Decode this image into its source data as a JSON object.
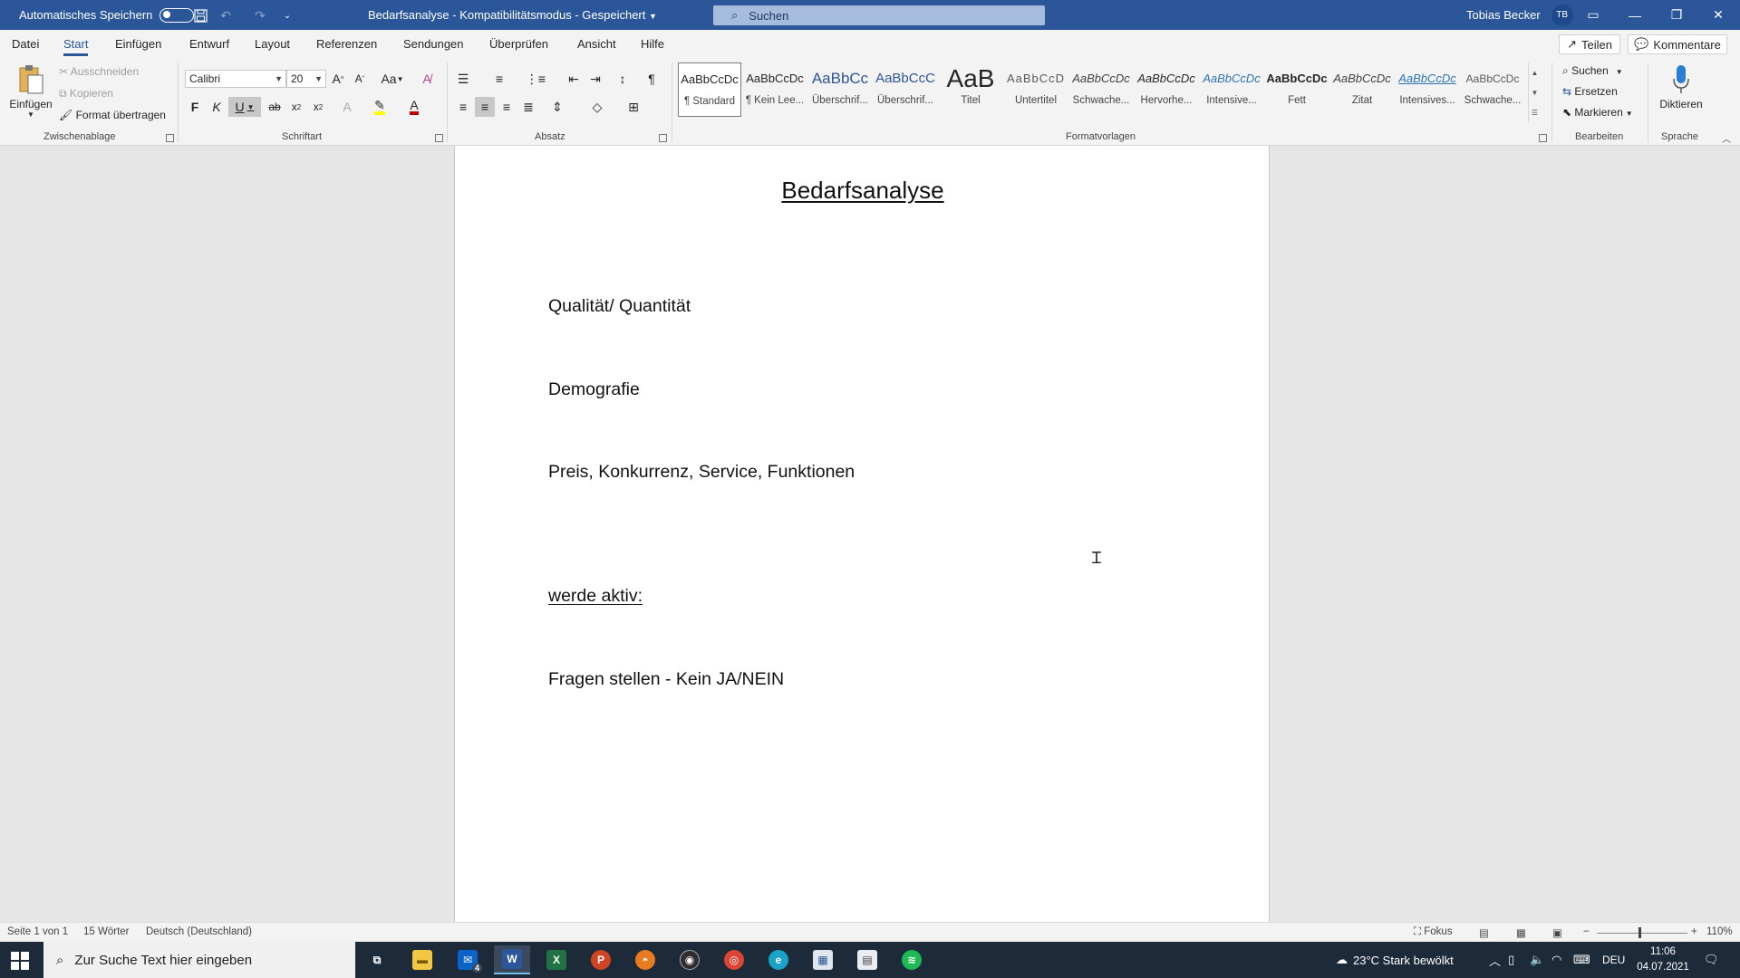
{
  "titlebar": {
    "autosave_label": "Automatisches Speichern",
    "document_title": "Bedarfsanalyse  -  Kompatibilitätsmodus  -  Gespeichert",
    "search_placeholder": "Suchen",
    "user_name": "Tobias Becker",
    "user_initials": "TB"
  },
  "tabs": [
    "Datei",
    "Start",
    "Einfügen",
    "Entwurf",
    "Layout",
    "Referenzen",
    "Sendungen",
    "Überprüfen",
    "Ansicht",
    "Hilfe"
  ],
  "active_tab": "Start",
  "share_label": "Teilen",
  "comments_label": "Kommentare",
  "ribbon": {
    "clipboard": {
      "paste": "Einfügen",
      "cut": "Ausschneiden",
      "copy": "Kopieren",
      "format_painter": "Format übertragen",
      "group": "Zwischenablage"
    },
    "font": {
      "name": "Calibri",
      "size": "20",
      "case": "Aa",
      "bold": "F",
      "italic": "K",
      "underline": "U",
      "group": "Schriftart"
    },
    "paragraph": {
      "group": "Absatz"
    },
    "styles": {
      "group": "Formatvorlagen",
      "items": [
        {
          "preview": "AaBbCcDc",
          "name": "¶ Standard"
        },
        {
          "preview": "AaBbCcDc",
          "name": "¶ Kein Lee..."
        },
        {
          "preview": "AaBbCc",
          "name": "Überschrif..."
        },
        {
          "preview": "AaBbCcC",
          "name": "Überschrif..."
        },
        {
          "preview": "AaB",
          "name": "Titel"
        },
        {
          "preview": "AaBbCcD",
          "name": "Untertitel"
        },
        {
          "preview": "AaBbCcDc",
          "name": "Schwache..."
        },
        {
          "preview": "AaBbCcDc",
          "name": "Hervorhe..."
        },
        {
          "preview": "AaBbCcDc",
          "name": "Intensive..."
        },
        {
          "preview": "AaBbCcDc",
          "name": "Fett"
        },
        {
          "preview": "AaBbCcDc",
          "name": "Zitat"
        },
        {
          "preview": "AaBbCcDc",
          "name": "Intensives..."
        },
        {
          "preview": "AaBbCcDc",
          "name": "Schwache..."
        }
      ]
    },
    "editing": {
      "find": "Suchen",
      "replace": "Ersetzen",
      "select": "Markieren",
      "group": "Bearbeiten"
    },
    "voice": {
      "dictate": "Diktieren",
      "group": "Sprache"
    }
  },
  "document": {
    "heading": "Bedarfsanalyse",
    "lines": [
      "Qualität/ Quantität",
      "Demografie",
      "Preis, Konkurrenz, Service, Funktionen",
      "werde aktiv:",
      "Fragen stellen - Kein JA/NEIN"
    ]
  },
  "statusbar": {
    "page": "Seite 1 von 1",
    "words": "15 Wörter",
    "language": "Deutsch (Deutschland)",
    "focus": "Fokus",
    "zoom": "110%",
    "zoom_minus": "−",
    "zoom_plus": "+"
  },
  "taskbar": {
    "search_placeholder": "Zur Suche Text hier eingeben",
    "mail_badge": "4",
    "weather": "23°C  Stark bewölkt",
    "language": "DEU",
    "time": "11:06",
    "date": "04.07.2021"
  },
  "colors": {
    "word_blue": "#2b579a",
    "ribbon_bg": "#f3f3f3",
    "canvas_bg": "#e6e6e6",
    "taskbar_bg": "#1c2a3a"
  }
}
